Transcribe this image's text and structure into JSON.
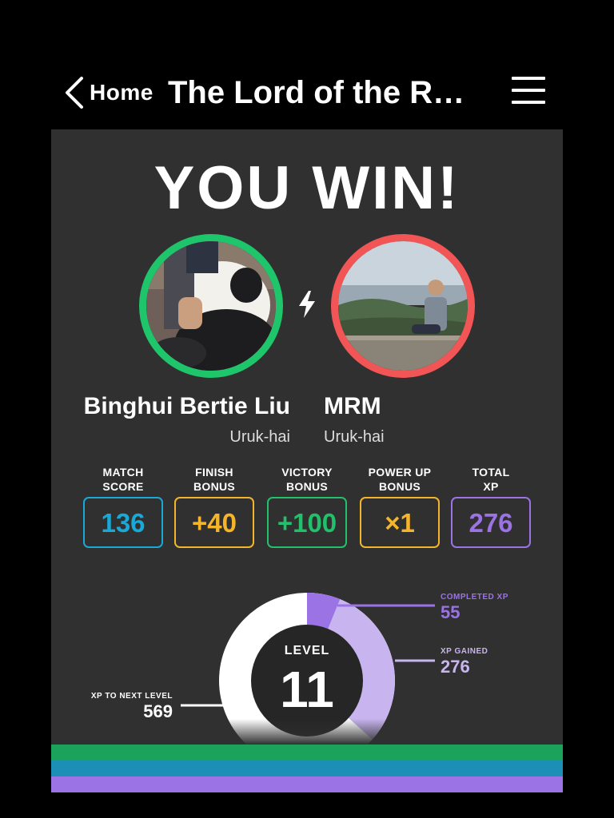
{
  "header": {
    "back_label": "Home",
    "title": "The Lord of the R…",
    "back_icon": "chevron-left-icon",
    "menu_icon": "hamburger-menu-icon"
  },
  "result": {
    "headline": "YOU WIN!"
  },
  "players": [
    {
      "name": "Binghui Bertie Liu",
      "team": "Uruk-hai",
      "ring_color": "#1ec56b"
    },
    {
      "name": "MRM",
      "team": "Uruk-hai",
      "ring_color": "#f25555"
    }
  ],
  "versus_icon": "lightning-bolt-icon",
  "stats": [
    {
      "label_line1": "MATCH",
      "label_line2": "SCORE",
      "value": "136",
      "color": "#1aa8d6"
    },
    {
      "label_line1": "FINISH",
      "label_line2": "BONUS",
      "value": "+40",
      "color": "#f4b52a"
    },
    {
      "label_line1": "VICTORY",
      "label_line2": "BONUS",
      "value": "+100",
      "color": "#22c06a"
    },
    {
      "label_line1": "POWER UP",
      "label_line2": "BONUS",
      "value": "×1",
      "color": "#f4b52a"
    },
    {
      "label_line1": "TOTAL",
      "label_line2": "XP",
      "value": "276",
      "color": "#9b73e4"
    }
  ],
  "level": {
    "label": "LEVEL",
    "number": "11",
    "completed_xp": {
      "label": "COMPLETED XP",
      "value": "55"
    },
    "xp_gained": {
      "label": "XP GAINED",
      "value": "276"
    },
    "xp_to_next": {
      "label": "XP TO NEXT LEVEL",
      "value": "569"
    }
  },
  "colors": {
    "completed": "#9b73e4",
    "gained": "#c8b4ee",
    "remaining": "#ffffff",
    "bar_green": "#1ca35b",
    "bar_blue": "#1b8fb6",
    "bar_purple": "#9b73e4"
  }
}
